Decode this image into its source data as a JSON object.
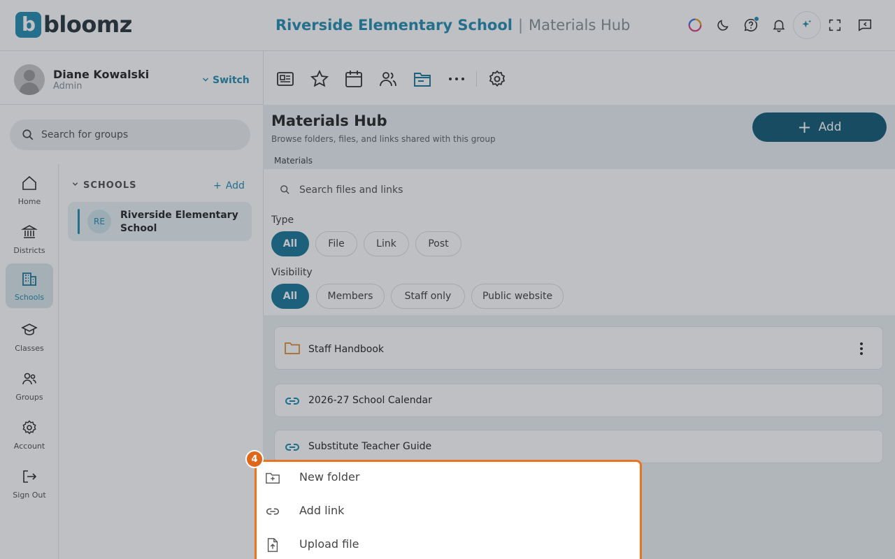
{
  "app": {
    "logo_letter": "b",
    "logo_text": "bloomz",
    "school_name": "Riverside Elementary School",
    "separator": "|",
    "section": "Materials Hub"
  },
  "header_icons": [
    "color-ring-icon",
    "moon-icon",
    "help-chat-icon",
    "bell-icon",
    "sparkle-icon",
    "fullscreen-icon",
    "message-icon"
  ],
  "user": {
    "name": "Diane Kowalski",
    "role": "Admin",
    "switch_label": "Switch"
  },
  "group_search": {
    "placeholder": "Search for groups"
  },
  "rail": [
    {
      "label": "Home",
      "icon": "home-icon"
    },
    {
      "label": "Districts",
      "icon": "districts-icon"
    },
    {
      "label": "Schools",
      "icon": "schools-icon",
      "active": true
    },
    {
      "label": "Classes",
      "icon": "classes-icon"
    },
    {
      "label": "Groups",
      "icon": "groups-icon"
    },
    {
      "label": "Account",
      "icon": "gear-icon"
    },
    {
      "label": "Sign Out",
      "icon": "sign-out-icon"
    }
  ],
  "schools_panel": {
    "header": "SCHOOLS",
    "add_label": "Add",
    "items": [
      {
        "initials": "RE",
        "name": "Riverside Elementary School"
      }
    ]
  },
  "toolbar": [
    "newsfeed-icon",
    "star-icon",
    "calendar-icon",
    "members-icon",
    "folder-icon",
    "more-icon",
    "settings-icon"
  ],
  "materials": {
    "title": "Materials Hub",
    "subtitle": "Browse folders, files, and links shared with this group",
    "breadcrumb": "Materials",
    "add_button": "Add",
    "search_placeholder": "Search files and links",
    "type_label": "Type",
    "type_filters": [
      "All",
      "File",
      "Link",
      "Post"
    ],
    "visibility_label": "Visibility",
    "visibility_filters": [
      "All",
      "Members",
      "Staff only",
      "Public website"
    ],
    "items": [
      {
        "kind": "folder",
        "name": "Staff Handbook"
      },
      {
        "kind": "link",
        "name": "2026-27 School Calendar"
      },
      {
        "kind": "link",
        "name": "Substitute Teacher Guide"
      }
    ]
  },
  "add_menu": {
    "step": "4",
    "items": [
      {
        "label": "New folder",
        "icon": "new-folder-icon"
      },
      {
        "label": "Add link",
        "icon": "link-icon"
      },
      {
        "label": "Upload file",
        "icon": "upload-file-icon"
      }
    ]
  },
  "colors": {
    "brand": "#2a8fb3",
    "primary_button": "#1a5f79",
    "highlight": "#e8741f"
  }
}
